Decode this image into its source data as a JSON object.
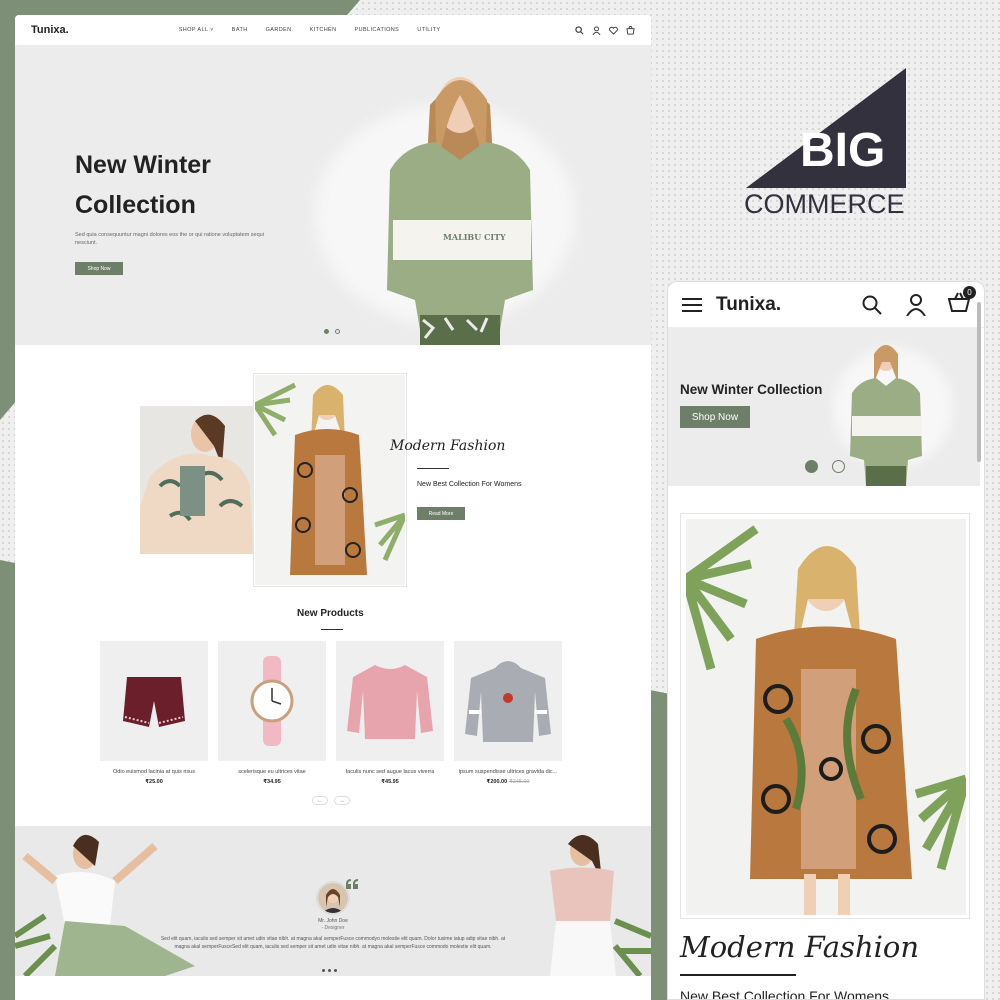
{
  "brand": {
    "name": "Tunixa."
  },
  "desktop": {
    "nav": {
      "items": [
        "SHOP ALL",
        "BATH",
        "GARDEN",
        "KITCHEN",
        "PUBLICATIONS",
        "UTILITY"
      ]
    },
    "hero": {
      "title_line1": "New Winter",
      "title_line2": "Collection",
      "text": "Sed quia consequuntur magni dolores eos the or qui ratione voluptatem sequi nesciunt.",
      "button": "Shop Now",
      "shirt_print": "MALIBU CITY"
    },
    "fashion": {
      "title": "Modern Fashion",
      "subtitle": "New Best Collection For Womens",
      "button": "Read More"
    },
    "products": {
      "title": "New Products",
      "items": [
        {
          "name": "Odio euismod lacinia at quis risus",
          "price": "₹25.00",
          "old": ""
        },
        {
          "name": "scelerisque eu ultrices vitae",
          "price": "₹34.95",
          "old": ""
        },
        {
          "name": "Iaculis nunc sed augue lacus viverra",
          "price": "₹45.95",
          "old": ""
        },
        {
          "name": "ipsum suspendisse ultrices gravida dic...",
          "price": "₹200.00",
          "old": "₹245.00"
        }
      ]
    },
    "testimonial": {
      "name": "Mr. John Doe",
      "role": "- Designer",
      "text": "Sed elit quam, iaculis sed semper sit amet udin vitae nibh. at magna akal semperFusce commodyo molestie elit quam. Dolor tusime iatup adip vitae nibh. at magna akal semperFusceSed elit quam, iaculis sed semper sit amet udin vitae nibh. at magna akal semperFusce commodo molestie elit quam."
    }
  },
  "bigcommerce": {
    "big": "BIG",
    "commerce": "COMMERCE"
  },
  "mobile": {
    "cart_count": "0",
    "hero": {
      "title": "New Winter Collection",
      "button": "Shop Now"
    },
    "fashion": {
      "title": "Modern Fashion",
      "subtitle": "New Best Collection For Womens"
    }
  },
  "colors": {
    "accent": "#6d7f68",
    "bg_green": "#7d8f76",
    "dark": "#222222"
  }
}
